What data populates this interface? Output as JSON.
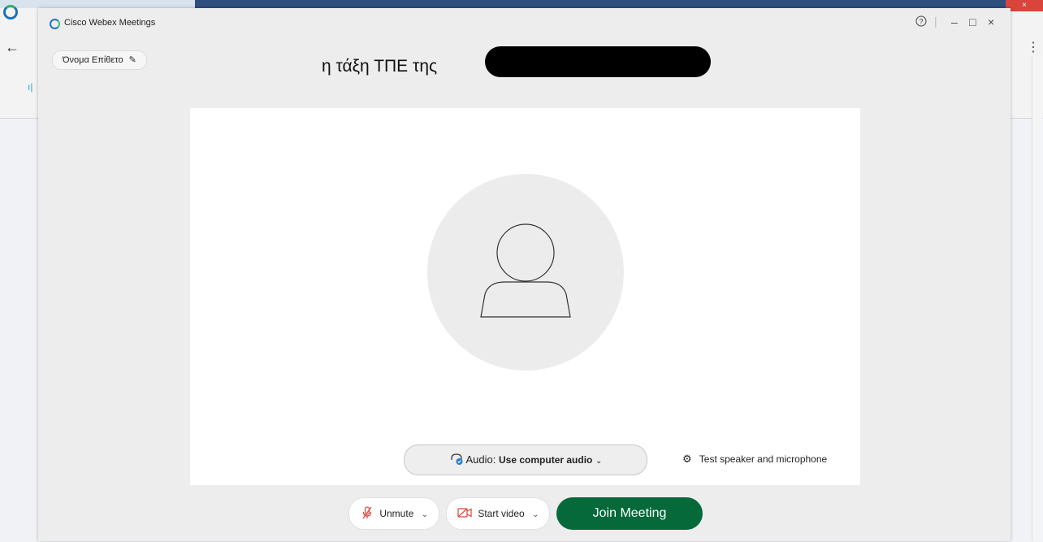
{
  "app": {
    "title": "Cisco Webex Meetings",
    "controls": {
      "help": "?",
      "minimize": "–",
      "maximize": "□",
      "close": "×"
    }
  },
  "user": {
    "display_name": "Όνομα Επίθετο"
  },
  "meeting": {
    "title": "η τάξη ΤΠΕ της"
  },
  "audio": {
    "prefix": "Audio:",
    "value": "Use computer audio"
  },
  "test": {
    "label": "Test speaker and microphone"
  },
  "buttons": {
    "unmute": "Unmute",
    "start_video": "Start video",
    "join": "Join Meeting"
  },
  "colors": {
    "join": "#06693a",
    "mic_red": "#d9443b"
  }
}
